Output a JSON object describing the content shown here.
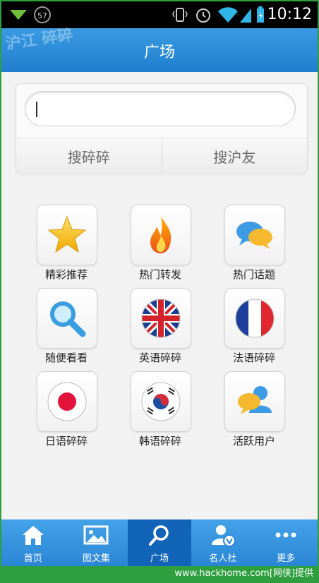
{
  "status_bar": {
    "battery_badge": "57",
    "time": "10:12"
  },
  "header": {
    "logo_text": "沪江 碎碎",
    "title": "广场"
  },
  "search": {
    "input_value": "",
    "buttons": [
      "搜碎碎",
      "搜沪友"
    ]
  },
  "grid": [
    {
      "label": "精彩推荐",
      "icon": "star-icon"
    },
    {
      "label": "热门转发",
      "icon": "fire-icon"
    },
    {
      "label": "热门话题",
      "icon": "chat-bubbles-icon"
    },
    {
      "label": "随便看看",
      "icon": "magnifier-icon"
    },
    {
      "label": "英语碎碎",
      "icon": "uk-flag-icon"
    },
    {
      "label": "法语碎碎",
      "icon": "france-flag-icon"
    },
    {
      "label": "日语碎碎",
      "icon": "japan-flag-icon"
    },
    {
      "label": "韩语碎碎",
      "icon": "korea-flag-icon"
    },
    {
      "label": "活跃用户",
      "icon": "active-users-icon"
    }
  ],
  "tabs": [
    {
      "label": "首页",
      "icon": "home-icon",
      "active": false
    },
    {
      "label": "图文集",
      "icon": "image-icon",
      "active": false
    },
    {
      "label": "广场",
      "icon": "search-icon",
      "active": true
    },
    {
      "label": "名人社",
      "icon": "celebrity-icon",
      "active": false
    },
    {
      "label": "更多",
      "icon": "more-icon",
      "active": false
    }
  ],
  "watermark": "www.hackhome.com[网侠]提供",
  "colors": {
    "title_blue": "#2a88d6",
    "active_tab": "#1264b8",
    "frame_green": "#2e9e3e"
  }
}
